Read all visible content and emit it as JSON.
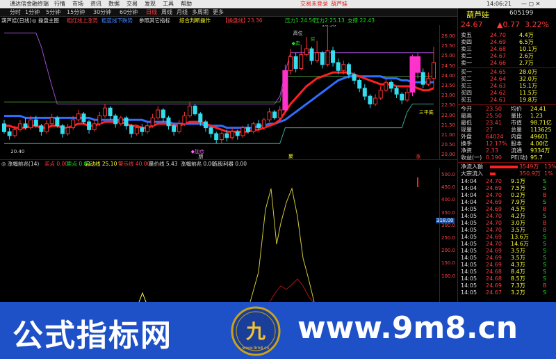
{
  "topbar": {
    "app_title": "通达信金融终端",
    "menus": [
      "行情",
      "市场",
      "资讯",
      "数据",
      "交易",
      "发现",
      "工具",
      "帮助"
    ],
    "login_label": "交易未登录",
    "stock_tag": "葫芦娃"
  },
  "toolbar": {
    "periods": [
      "分时",
      "1分钟",
      "5分钟",
      "15分钟",
      "30分钟",
      "60分钟",
      "日线",
      "周线",
      "月线",
      "多周期",
      "更多"
    ],
    "active_period": "日线"
  },
  "legend": {
    "items": [
      {
        "text": "葫芦娃(日线)",
        "color": "#dddddd"
      },
      {
        "text": "◎ 操盘主图",
        "color": "#dddddd"
      },
      {
        "text": "粗红线上涨势",
        "color": "#ff3b3b"
      },
      {
        "text": "粗蓝线下跌势",
        "color": "#4488ff"
      },
      {
        "text": "参照其它指标",
        "color": "#dddddd"
      },
      {
        "text": "综合判断操作",
        "color": "#ffff33"
      },
      {
        "text": "【操盘线】",
        "color": "#ff3b3b"
      },
      {
        "text": "23.36",
        "color": "#ff3b3b"
      },
      {
        "text": "压力1:24.56",
        "color": "#22dd22"
      },
      {
        "text": "压力2:25.13",
        "color": "#22dd22"
      },
      {
        "text": "支撑:22.43",
        "color": "#22dd22"
      }
    ]
  },
  "main_chart": {
    "ylim": [
      19.8,
      26.6
    ],
    "y_ticks": [
      "26.00",
      "25.50",
      "25.00",
      "24.50",
      "24.00",
      "23.50",
      "23.00",
      "22.50",
      "22.00",
      "21.50",
      "21.00",
      "20.50",
      "20.00"
    ],
    "annotations": {
      "high": "26.50",
      "low": "20.40",
      "stage_label": "三平底",
      "position_label": "高位",
      "sell_label": "◆卖",
      "buy_label": "买",
      "add_label": "◆加仓",
      "bottom_labels": [
        "朋",
        "聚",
        "涨"
      ]
    }
  },
  "sub_legend": {
    "items": [
      {
        "text": "◎ 涨幅前兆(14)",
        "color": "#dddddd"
      },
      {
        "text": "买点 0.00",
        "color": "#ff3b3b"
      },
      {
        "text": "卖点 0.00",
        "color": "#22dd22"
      },
      {
        "text": "启动线 25.10",
        "color": "#ffff33"
      },
      {
        "text": "警示线 40.00",
        "color": "#ff3b3b"
      },
      {
        "text": "量价线 5.43",
        "color": "#dddddd"
      },
      {
        "text": "涨幅前兆 0.00",
        "color": "#dddddd"
      },
      {
        "text": "选股利器 0.00",
        "color": "#dddddd"
      }
    ]
  },
  "indicator_chart": {
    "ylim": [
      0,
      530
    ],
    "y_ticks": [
      "500.0",
      "450.0",
      "400.0",
      "350.0",
      "300.0",
      "250.0",
      "200.0",
      "150.0",
      "100.0"
    ],
    "current_value": "318.00"
  },
  "side": {
    "name": "葫芦娃",
    "code": "605199",
    "price": "24.67",
    "change": "▲0.77",
    "pct": "3.22%",
    "asks": [
      {
        "label": "卖五",
        "mark": "Y",
        "price": "24.70",
        "vol": "4.4万"
      },
      {
        "label": "卖四",
        "mark": "",
        "price": "24.69",
        "vol": "6.5万"
      },
      {
        "label": "卖三",
        "mark": "",
        "price": "24.68",
        "vol": "10.1万"
      },
      {
        "label": "卖二",
        "mark": "",
        "price": "24.67",
        "vol": "2.6万"
      },
      {
        "label": "卖一",
        "mark": "",
        "price": "24.66",
        "vol": "2.7万"
      }
    ],
    "bids": [
      {
        "label": "买一",
        "price": "24.65",
        "vol": "28.0万"
      },
      {
        "label": "买二",
        "price": "24.64",
        "vol": "32.0万"
      },
      {
        "label": "买三",
        "price": "24.63",
        "vol": "15.1万"
      },
      {
        "label": "买四",
        "price": "24.62",
        "vol": "11.5万"
      },
      {
        "label": "买五",
        "price": "24.61",
        "vol": "19.8万"
      }
    ],
    "stats": [
      {
        "l1": "今开",
        "v1": "23.50",
        "l2": "均价",
        "v2": "24.41"
      },
      {
        "l1": "最高",
        "v1": "25.50",
        "l2": "量比",
        "v2": "1.23"
      },
      {
        "l1": "最低",
        "v1": "23.41",
        "l2": "市值",
        "v2": "98.71亿"
      },
      {
        "l1": "现量",
        "v1": "27",
        "l2": "总量",
        "v2": "113625"
      },
      {
        "l1": "外盘",
        "v1": "64024",
        "l2": "内盘",
        "v2": "49601"
      },
      {
        "l1": "换手",
        "v1": "12.17%",
        "l2": "股本",
        "v2": "4.00亿"
      },
      {
        "l1": "净资",
        "v1": "2.33",
        "l2": "流通",
        "v2": "9334万"
      },
      {
        "l1": "收益(一)",
        "v1": "0.190",
        "l2": "PE(动)",
        "v2": "95.7"
      }
    ],
    "flow": [
      {
        "label": "净流入额",
        "value": "3549万",
        "pct": "13%"
      },
      {
        "label": "大宗流入",
        "value": "350.9万",
        "pct": "1%"
      }
    ],
    "ticks": [
      {
        "t": "14:04",
        "p": "24.70",
        "v": "9.1万",
        "d": "S"
      },
      {
        "t": "14:04",
        "p": "24.69",
        "v": "7.5万",
        "d": "S"
      },
      {
        "t": "14:04",
        "p": "24.70",
        "v": "0.2万",
        "d": "B"
      },
      {
        "t": "14:04",
        "p": "24.69",
        "v": "7.9万",
        "d": "S"
      },
      {
        "t": "14:05",
        "p": "24.69",
        "v": "4.5万",
        "d": "B"
      },
      {
        "t": "14:05",
        "p": "24.70",
        "v": "4.2万",
        "d": "S"
      },
      {
        "t": "14:05",
        "p": "24.70",
        "v": "3.0万",
        "d": "B"
      },
      {
        "t": "14:05",
        "p": "24.70",
        "v": "3.5万",
        "d": "B"
      },
      {
        "t": "14:05",
        "p": "24.69",
        "v": "13.6万",
        "d": "S"
      },
      {
        "t": "14:05",
        "p": "24.70",
        "v": "14.6万",
        "d": "S"
      },
      {
        "t": "14:05",
        "p": "24.69",
        "v": "3.5万",
        "d": "S"
      },
      {
        "t": "14:05",
        "p": "24.69",
        "v": "3.5万",
        "d": "S"
      },
      {
        "t": "14:05",
        "p": "24.69",
        "v": "4.3万",
        "d": "S"
      },
      {
        "t": "14:05",
        "p": "24.68",
        "v": "8.4万",
        "d": "S"
      },
      {
        "t": "14:05",
        "p": "24.68",
        "v": "8.5万",
        "d": "S"
      },
      {
        "t": "14:05",
        "p": "24.69",
        "v": "7.3万",
        "d": "B"
      },
      {
        "t": "14:05",
        "p": "24.67",
        "v": "3.2万",
        "d": "S"
      },
      {
        "t": "14:05",
        "p": "24.66",
        "v": "6.1万",
        "d": "S"
      }
    ]
  },
  "clock": "14:06:21",
  "watermark": {
    "left": "公式指标网",
    "right": "www.9m8.cn",
    "logo_glyph": "九",
    "logo_caption": "www.9m8.cn"
  },
  "chart_data": {
    "type": "candlestick",
    "ylim": [
      19.8,
      26.6
    ],
    "candles": [
      [
        21.6,
        21.2,
        21.8,
        21.1
      ],
      [
        21.2,
        21.0,
        21.4,
        20.8
      ],
      [
        21.0,
        21.3,
        21.5,
        20.9
      ],
      [
        21.3,
        21.6,
        21.8,
        21.2
      ],
      [
        21.6,
        21.4,
        21.9,
        21.3
      ],
      [
        21.4,
        21.8,
        22.0,
        21.3
      ],
      [
        21.8,
        21.5,
        22.0,
        21.4
      ],
      [
        21.5,
        21.2,
        21.6,
        21.0
      ],
      [
        21.2,
        21.6,
        21.8,
        21.1
      ],
      [
        21.6,
        21.9,
        22.1,
        21.5
      ],
      [
        21.9,
        21.5,
        22.0,
        21.4
      ],
      [
        21.5,
        21.1,
        21.6,
        20.9
      ],
      [
        21.1,
        21.4,
        21.6,
        21.0
      ],
      [
        21.4,
        21.8,
        22.0,
        21.3
      ],
      [
        21.8,
        22.1,
        22.3,
        21.7
      ],
      [
        22.1,
        21.7,
        22.2,
        21.6
      ],
      [
        21.7,
        21.3,
        21.8,
        21.1
      ],
      [
        21.3,
        21.6,
        21.8,
        21.2
      ],
      [
        21.6,
        22.0,
        22.2,
        21.5
      ],
      [
        22.0,
        22.4,
        22.6,
        21.9
      ],
      [
        22.4,
        22.0,
        22.5,
        21.8
      ],
      [
        22.0,
        21.6,
        22.1,
        21.4
      ],
      [
        21.6,
        21.9,
        22.0,
        21.5
      ],
      [
        21.9,
        21.5,
        22.0,
        21.3
      ],
      [
        21.5,
        21.1,
        21.6,
        20.9
      ],
      [
        21.1,
        21.4,
        21.5,
        21.0
      ],
      [
        21.4,
        21.2,
        21.6,
        21.0
      ],
      [
        21.2,
        21.5,
        21.7,
        21.1
      ],
      [
        21.5,
        21.9,
        22.1,
        21.4
      ],
      [
        21.9,
        22.3,
        22.5,
        21.8
      ],
      [
        22.3,
        21.9,
        22.4,
        21.7
      ],
      [
        21.9,
        21.5,
        22.0,
        21.3
      ],
      [
        21.5,
        21.2,
        21.6,
        21.0
      ],
      [
        21.2,
        21.6,
        21.8,
        21.1
      ],
      [
        21.6,
        22.0,
        22.2,
        21.5
      ],
      [
        22.0,
        22.5,
        22.7,
        21.9
      ],
      [
        22.5,
        22.1,
        22.6,
        22.0
      ],
      [
        22.1,
        21.7,
        22.2,
        21.5
      ],
      [
        21.7,
        21.4,
        21.8,
        21.2
      ],
      [
        21.4,
        21.1,
        21.5,
        20.9
      ],
      [
        21.1,
        20.8,
        21.2,
        20.6
      ],
      [
        20.8,
        21.1,
        21.2,
        20.6
      ],
      [
        21.1,
        20.9,
        21.3,
        20.7
      ],
      [
        20.9,
        21.2,
        21.4,
        20.8
      ],
      [
        21.2,
        21.0,
        21.3,
        20.8
      ],
      [
        21.0,
        21.4,
        21.5,
        20.9
      ],
      [
        21.4,
        21.2,
        21.6,
        21.1
      ],
      [
        21.2,
        21.6,
        21.7,
        21.1
      ],
      [
        21.6,
        21.4,
        21.8,
        21.3
      ],
      [
        21.4,
        21.8,
        21.9,
        21.3
      ],
      [
        21.8,
        22.2,
        22.4,
        21.7
      ],
      [
        22.2,
        21.9,
        22.3,
        21.8
      ],
      [
        21.9,
        22.3,
        22.5,
        21.8
      ],
      [
        22.3,
        24.3,
        24.6,
        22.2
      ],
      [
        24.3,
        25.0,
        25.4,
        24.1
      ],
      [
        25.0,
        24.4,
        25.2,
        24.2
      ],
      [
        24.4,
        25.1,
        25.6,
        24.3
      ],
      [
        25.1,
        25.4,
        26.0,
        25.0
      ],
      [
        25.4,
        24.8,
        25.5,
        24.6
      ],
      [
        24.8,
        25.2,
        25.8,
        24.7
      ],
      [
        25.2,
        24.6,
        25.3,
        24.4
      ],
      [
        24.6,
        25.3,
        26.5,
        24.5
      ],
      [
        25.3,
        24.7,
        25.5,
        24.5
      ],
      [
        24.7,
        24.3,
        24.9,
        24.1
      ],
      [
        24.3,
        24.6,
        24.8,
        24.1
      ],
      [
        24.6,
        24.1,
        24.7,
        23.9
      ],
      [
        24.1,
        23.8,
        24.2,
        23.6
      ],
      [
        23.8,
        23.4,
        23.9,
        23.2
      ],
      [
        23.4,
        23.0,
        23.6,
        22.8
      ],
      [
        23.0,
        22.6,
        23.1,
        22.4
      ],
      [
        22.6,
        22.9,
        23.1,
        22.5
      ],
      [
        22.9,
        23.3,
        23.5,
        22.8
      ],
      [
        23.3,
        23.7,
        23.9,
        23.2
      ],
      [
        23.7,
        23.4,
        23.8,
        23.2
      ],
      [
        23.4,
        23.1,
        23.5,
        22.9
      ],
      [
        23.1,
        22.8,
        23.2,
        22.6
      ],
      [
        22.8,
        23.2,
        23.4,
        22.7
      ],
      [
        23.2,
        25.0,
        25.1,
        23.0
      ],
      [
        25.0,
        24.2,
        25.2,
        23.9
      ],
      [
        24.2,
        23.6,
        24.4,
        23.4
      ],
      [
        23.6,
        23.9,
        24.2,
        23.5
      ],
      [
        23.9,
        24.7,
        25.5,
        23.4
      ]
    ],
    "highlight_bars": [
      53,
      77,
      78
    ],
    "red_line": [
      21.5,
      21.5,
      21.4,
      21.4,
      21.4,
      21.5,
      21.5,
      21.4,
      21.4,
      21.5,
      21.5,
      21.4,
      21.4,
      21.5,
      21.6,
      21.6,
      21.5,
      21.5,
      21.6,
      21.7,
      21.7,
      21.7,
      21.7,
      21.6,
      21.5,
      21.5,
      21.4,
      21.4,
      21.5,
      21.6,
      21.6,
      21.6,
      21.5,
      21.5,
      21.6,
      21.7,
      21.7,
      21.7,
      21.6,
      21.5,
      21.4,
      21.3,
      21.2,
      21.2,
      21.2,
      21.2,
      21.2,
      21.3,
      21.3,
      21.4,
      21.5,
      21.6,
      21.8,
      22.2,
      22.6,
      22.9,
      23.2,
      23.5,
      23.7,
      23.9,
      24.0,
      24.1,
      24.2,
      24.2,
      24.2,
      24.2,
      24.1,
      24.0,
      23.9,
      23.8,
      23.7,
      23.6,
      23.6,
      23.6,
      23.5,
      23.5,
      23.5,
      23.5,
      23.4,
      23.3,
      23.3,
      23.4
    ],
    "blue_line": [
      22.0,
      22.0,
      22.0,
      22.0,
      21.9,
      21.9,
      21.9,
      21.9,
      21.9,
      21.9,
      21.9,
      21.9,
      21.9,
      21.9,
      21.9,
      21.9,
      21.9,
      21.8,
      21.8,
      21.8,
      21.8,
      21.8,
      21.8,
      21.8,
      21.8,
      21.8,
      21.8,
      21.7,
      21.7,
      21.7,
      21.7,
      21.7,
      21.6,
      21.6,
      21.6,
      21.6,
      21.6,
      21.6,
      21.5,
      21.5,
      21.5,
      21.5,
      21.4,
      21.4,
      21.4,
      21.4,
      21.4,
      21.4,
      21.5,
      21.5,
      21.6,
      21.6,
      21.7,
      21.8,
      22.0,
      22.2,
      22.4,
      22.6,
      22.8,
      23.0,
      23.2,
      23.4,
      23.6,
      23.8,
      23.9,
      24.0,
      24.0,
      24.0,
      24.0,
      24.0,
      24.0,
      24.0,
      23.9,
      23.9,
      23.9,
      23.8,
      23.8,
      23.7,
      23.7,
      23.7,
      23.7,
      23.7
    ],
    "purple_line": [
      26.2,
      26.2,
      26.2,
      26.2,
      26.2,
      26.2,
      26.2,
      25.5,
      24.5,
      23.5,
      22.6,
      22.6,
      22.6,
      22.6,
      22.6,
      22.6,
      22.6,
      22.6,
      22.6,
      22.6,
      22.6,
      22.6,
      22.6,
      22.6,
      22.6,
      22.6,
      22.6,
      22.6,
      22.6,
      22.6,
      22.6,
      22.6,
      22.6,
      22.6,
      22.6,
      22.6,
      22.6,
      22.6,
      22.6,
      22.6,
      22.6,
      22.6,
      22.6,
      22.6,
      22.6,
      22.6,
      22.6,
      22.6,
      22.6,
      22.6,
      22.6,
      22.6,
      23.0,
      24.2,
      25.2,
      25.2,
      25.2,
      25.2,
      25.2,
      25.2,
      25.2,
      25.2,
      25.2,
      25.2,
      25.2,
      25.2,
      25.2,
      25.2,
      25.2,
      25.2,
      25.2,
      25.2,
      25.2,
      25.2,
      25.2,
      25.2,
      25.2,
      25.2,
      25.2,
      25.2,
      25.2,
      25.2
    ],
    "green_line": [
      22.7,
      22.7,
      22.7,
      22.7,
      22.7,
      22.7,
      22.7,
      22.7,
      22.7,
      22.7,
      22.7,
      22.7,
      22.7,
      22.7,
      22.7,
      22.7,
      22.7,
      22.7,
      22.7,
      22.7,
      22.7,
      22.7,
      22.7,
      22.7,
      22.7,
      22.7,
      22.7,
      22.7,
      22.7,
      22.7,
      22.7,
      22.7,
      22.7,
      22.7,
      22.7,
      22.7,
      22.7,
      22.7,
      22.7,
      22.7,
      22.7,
      22.7,
      22.7,
      22.7,
      22.7,
      22.7,
      22.7,
      22.7,
      22.7,
      22.7,
      22.7,
      22.7,
      22.7,
      24.0,
      24.0,
      24.0,
      24.0,
      24.0,
      24.0,
      24.0,
      24.0,
      24.0,
      24.0,
      24.0,
      24.0,
      24.0,
      24.0,
      24.0,
      24.0,
      24.0,
      24.0,
      24.0,
      24.0,
      24.0,
      24.0,
      24.0,
      24.0,
      24.0,
      24.0,
      24.0,
      24.0,
      24.0
    ],
    "teal_line": [
      20.6,
      20.6,
      20.6,
      20.6,
      20.6,
      20.6,
      20.6,
      20.6,
      20.6,
      20.6,
      20.6,
      20.6,
      20.6,
      20.6,
      20.6,
      20.6,
      20.6,
      20.6,
      20.6,
      20.6,
      20.6,
      20.6,
      20.6,
      20.6,
      20.6,
      20.6,
      20.6,
      20.6,
      20.6,
      20.6,
      20.6,
      20.6,
      20.6,
      20.6,
      20.6,
      20.6,
      20.6,
      20.6,
      20.6,
      20.6,
      20.6,
      20.6,
      20.6,
      20.6,
      20.6,
      20.6,
      20.6,
      20.6,
      20.6,
      20.6,
      20.6,
      20.6,
      20.6,
      21.4,
      21.4,
      21.4,
      21.4,
      21.4,
      21.4,
      21.4,
      21.4,
      21.4,
      21.4,
      21.4,
      21.4,
      21.4,
      21.4,
      21.4,
      21.4,
      21.4,
      21.4,
      21.4,
      21.4,
      21.4,
      21.4,
      21.4,
      22.2,
      22.6,
      22.6,
      22.6,
      22.6,
      22.6
    ],
    "indicator": {
      "yellow_line": [
        0,
        0,
        0,
        0,
        0,
        0,
        0,
        0,
        0,
        0,
        0,
        0,
        0,
        0,
        0,
        0,
        0,
        0,
        0,
        0,
        0,
        0,
        0,
        0,
        0,
        0,
        0,
        0,
        0,
        0,
        0,
        0,
        0,
        0,
        0,
        0,
        0,
        0,
        0,
        0,
        0,
        0,
        0,
        0,
        0,
        0,
        0,
        0,
        0,
        0,
        0,
        0,
        0,
        0,
        0,
        80,
        0,
        0,
        0,
        0,
        0,
        0,
        0,
        0,
        0,
        0,
        0,
        0,
        0,
        0,
        0,
        0,
        0,
        0,
        0,
        0,
        0,
        0,
        0,
        0,
        0,
        0
      ],
      "series_points": [
        {
          "name": "yellow",
          "x": [
            0,
            25,
            27,
            29,
            31,
            33,
            35,
            38,
            40,
            42,
            44,
            46,
            47,
            49,
            51,
            53,
            55,
            57,
            58,
            59,
            60,
            61
          ],
          "y": [
            0,
            0,
            40,
            120,
            160,
            60,
            0,
            0,
            20,
            60,
            140,
            150,
            0,
            20,
            0,
            0,
            0,
            0,
            0,
            0,
            0,
            0
          ]
        }
      ]
    }
  }
}
